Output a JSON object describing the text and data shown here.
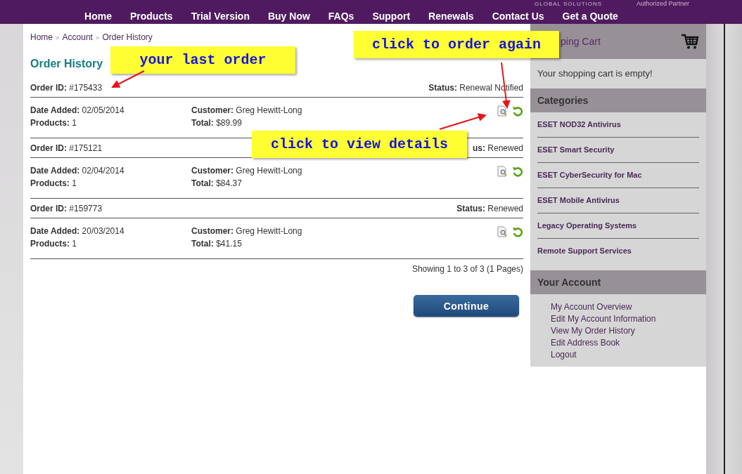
{
  "top_bar": {
    "brand_tagline": "GLOBAL SOLUTIONS",
    "partner_label": "Authorized Partner"
  },
  "nav": [
    {
      "label": "Home"
    },
    {
      "label": "Products"
    },
    {
      "label": "Trial Version"
    },
    {
      "label": "Buy Now"
    },
    {
      "label": "FAQs"
    },
    {
      "label": "Support"
    },
    {
      "label": "Renewals"
    },
    {
      "label": "Contact Us"
    },
    {
      "label": "Get a Quote"
    }
  ],
  "breadcrumb": [
    {
      "kind": "link",
      "text": "Home"
    },
    {
      "kind": "separator",
      "text": "»"
    },
    {
      "kind": "link",
      "text": "Account"
    },
    {
      "kind": "separator",
      "text": "»"
    },
    {
      "kind": "link",
      "text": "Order History"
    }
  ],
  "title": "Order History",
  "orders": [
    {
      "id_label": "Order ID:",
      "id": "#175433",
      "status_label": "Status:",
      "status": "Renewal Notified",
      "date_label": "Date Added:",
      "date": "02/05/2014",
      "products_label": "Products:",
      "products": "1",
      "customer_label": "Customer:",
      "customer": "Greg Hewitt-Long",
      "total_label": "Total:",
      "total": "$89.99"
    },
    {
      "id_label": "Order ID:",
      "id": "#175121",
      "status_label": "us:",
      "status": "Renewed",
      "date_label": "Date Added:",
      "date": "02/04/2014",
      "products_label": "Products:",
      "products": "1",
      "customer_label": "Customer:",
      "customer": "Greg Hewitt-Long",
      "total_label": "Total:",
      "total": "$84.37"
    },
    {
      "id_label": "Order ID:",
      "id": "#159773",
      "status_label": "Status:",
      "status": "Renewed",
      "date_label": "Date Added:",
      "date": "20/03/2014",
      "products_label": "Products:",
      "products": "1",
      "customer_label": "Customer:",
      "customer": "Greg Hewitt-Long",
      "total_label": "Total:",
      "total": "$41.15"
    }
  ],
  "pagination": "Showing 1 to 3 of 3 (1 Pages)",
  "continue_button": "Continue",
  "sidebar": {
    "cart": {
      "title": "ping Cart",
      "message": "Your shopping cart is empty!"
    },
    "categories": {
      "title": "Categories",
      "items": [
        "ESET NOD32 Antivirus",
        "ESET Smart Security",
        "ESET CyberSecurity for Mac",
        "ESET Mobile Antivirus",
        "Legacy Operating Systems",
        "Remote Support Services"
      ]
    },
    "account": {
      "title": "Your Account",
      "links": [
        "My Account Overview",
        "Edit My Account Information",
        "View My Order History",
        "Edit Address Book",
        "Logout"
      ]
    }
  },
  "callouts": [
    {
      "text": "your last order"
    },
    {
      "text": "click to order again"
    },
    {
      "text": "click to view details"
    }
  ]
}
